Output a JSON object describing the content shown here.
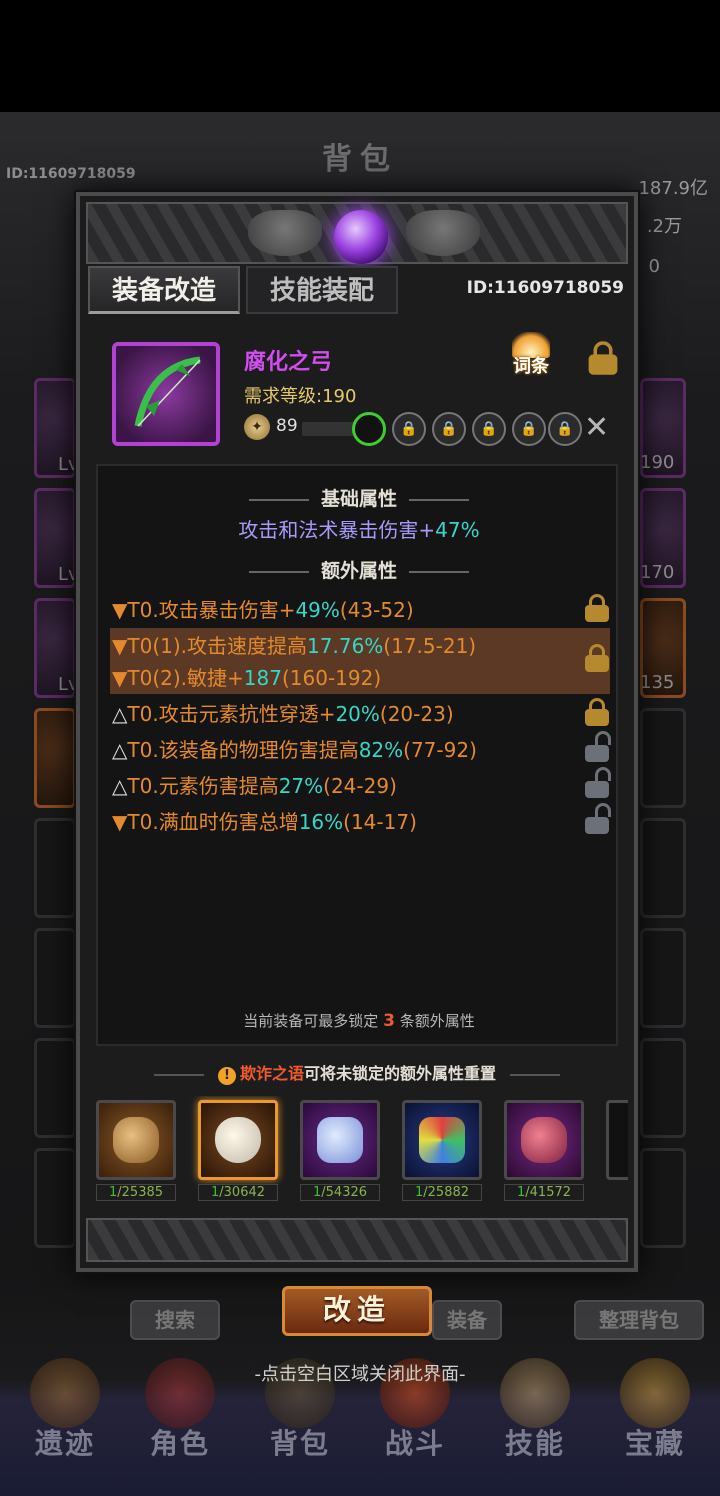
{
  "background": {
    "title": "背包",
    "player_id": "ID:11609718059",
    "currency": [
      "187.9亿",
      ".2万",
      "0"
    ],
    "slot_levels": [
      "Lv",
      "Lv",
      "Lv",
      "190",
      "170",
      "135"
    ],
    "buttons": {
      "search": "搜索",
      "equip": "装备",
      "sort": "整理背包"
    },
    "nav": [
      "遗迹",
      "角色",
      "背包",
      "战斗",
      "技能",
      "宝藏"
    ]
  },
  "modal": {
    "tabs": [
      {
        "label": "装备改造",
        "active": true
      },
      {
        "label": "技能装配",
        "active": false
      }
    ],
    "item_id": "ID:11609718059",
    "item": {
      "name": "腐化之弓",
      "level_requirement": "需求等级:190",
      "power": "89",
      "affix_button": "词条",
      "sockets": {
        "open": 1,
        "locked": 5
      },
      "name_color": "#d24df0"
    },
    "base_title": "基础属性",
    "base_attr": {
      "text": "攻击和法术暴击伤害+",
      "value": "47%"
    },
    "extra_title": "额外属性",
    "affixes": [
      {
        "prefix": "▼",
        "text": "T0.攻击暴击伤害+",
        "value": "49%",
        "range": "(43-52)",
        "lock": "gold"
      },
      {
        "prefix": "▼",
        "text": "T0(1).攻击速度提高",
        "value": "17.76%",
        "range": "(17.5-21)",
        "lock": "gold"
      },
      {
        "prefix": "▼",
        "text": "T0(2).敏捷+",
        "value": "187",
        "range": "(160-192)",
        "lock": ""
      },
      {
        "prefix": "△",
        "text": "T0.攻击元素抗性穿透+",
        "value": "20%",
        "range": "(20-23)",
        "lock": "gold"
      },
      {
        "prefix": "△",
        "text": "T0.该装备的物理伤害提高",
        "value": "82%",
        "range": "(77-92)",
        "lock": "grey"
      },
      {
        "prefix": "△",
        "text": "T0.元素伤害提高",
        "value": "27%",
        "range": "(24-29)",
        "lock": "grey"
      },
      {
        "prefix": "▼",
        "text": "T0.满血时伤害总增",
        "value": "16%",
        "range": "(14-17)",
        "lock": "grey"
      }
    ],
    "lock_note": {
      "before": "当前装备可最多锁定",
      "count": "3",
      "after": "条额外属性"
    },
    "hint": {
      "icon": "!",
      "highlight": "欺诈之语",
      "text": "可将未锁定的额外属性重置"
    },
    "materials": [
      {
        "name": "orb-material",
        "owned": "1",
        "total": "/25385",
        "color": "#b9772f"
      },
      {
        "name": "mask-material",
        "owned": "1",
        "total": "/30642",
        "color": "#e8e0d0",
        "selected": true
      },
      {
        "name": "crystal-material",
        "owned": "1",
        "total": "/54326",
        "color": "#8fa6e8"
      },
      {
        "name": "gem-material",
        "owned": "1",
        "total": "/25882",
        "color": "#5a9ad8"
      },
      {
        "name": "rune-material",
        "owned": "1",
        "total": "/41572",
        "color": "#c0405a"
      }
    ]
  },
  "transform_button": "改造",
  "close_hint": "-点击空白区域关闭此界面-",
  "colors": {
    "accent_cyan": "#37d6c7",
    "affix_orange": "#e58a2c",
    "epic_purple": "#b341d4"
  }
}
